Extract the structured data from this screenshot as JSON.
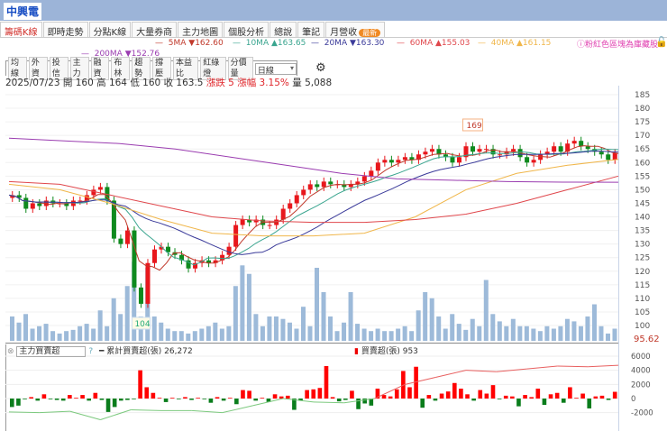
{
  "title": "中興電",
  "tabs": [
    {
      "label": "籌碼K線",
      "active": true
    },
    {
      "label": "即時走勢"
    },
    {
      "label": "分點K線"
    },
    {
      "label": "大量券商"
    },
    {
      "label": "主力地圖"
    },
    {
      "label": "個股分析"
    },
    {
      "label": "總說"
    },
    {
      "label": "筆記"
    },
    {
      "label": "月營收",
      "badge": "最新"
    }
  ],
  "ma_legend": [
    {
      "label": "5MA",
      "dir": "▼",
      "value": "162.60",
      "color": "#c0392b"
    },
    {
      "label": "10MA",
      "dir": "▲",
      "value": "163.65",
      "color": "#3aa58f"
    },
    {
      "label": "20MA",
      "dir": "▼",
      "value": "163.30",
      "color": "#3b3b9a"
    },
    {
      "label": "60MA",
      "dir": "▲",
      "value": "155.03",
      "color": "#e0474c"
    },
    {
      "label": "40MA",
      "dir": "▲",
      "value": "161.15",
      "color": "#f0b64a"
    },
    {
      "label": "200MA",
      "dir": "▼",
      "value": "152.76",
      "color": "#9a3cb0"
    }
  ],
  "note": "粉紅色區塊為庫藏股",
  "toolbar": [
    "均線",
    "外資",
    "投信",
    "主力",
    "融資",
    "布林",
    "趨勢",
    "撐壓",
    "本益比",
    "紅綠燈",
    "分價量"
  ],
  "period_select": "日線",
  "info": {
    "date": "2025/07/23",
    "open": "開 160",
    "high": "高 164",
    "low": "低 160",
    "close": "收 163.5",
    "change": "漲跌 5",
    "pct": "漲幅 3.15%",
    "volume": "量 5,088"
  },
  "lower": {
    "select": "主力買賣超",
    "help": "?",
    "cum_label": "累計買賣超(張) 26,272",
    "daily_label": "買賣超(張) 953"
  },
  "chart_data": {
    "type": "candlestick",
    "y_ticks": [
      185,
      180,
      175,
      170,
      165,
      160,
      155,
      150,
      145,
      140,
      135,
      130,
      125,
      120,
      115,
      110,
      105,
      100
    ],
    "ylim": [
      95,
      187
    ],
    "last_label": "95.62",
    "high_marker": "169",
    "low_marker": "104",
    "closes": [
      148,
      147,
      143,
      145,
      144,
      146,
      145,
      145,
      144,
      146,
      146,
      148,
      150,
      151,
      146,
      132,
      130,
      135,
      114,
      108,
      123,
      128,
      129,
      127,
      126,
      124,
      121,
      123,
      124,
      123,
      124,
      126,
      129,
      137,
      139,
      138,
      139,
      137,
      137,
      139,
      143,
      145,
      148,
      150,
      152,
      151,
      153,
      152,
      152,
      151,
      152,
      153,
      155,
      157,
      160,
      161,
      160,
      161,
      162,
      161,
      163,
      164,
      165,
      163,
      162,
      160,
      162,
      166,
      164,
      165,
      165,
      163,
      163,
      164,
      165,
      162,
      160,
      161,
      163,
      164,
      166,
      164,
      167,
      168,
      166,
      165,
      164,
      163,
      161,
      163.5
    ],
    "volumes": [
      20,
      15,
      22,
      10,
      12,
      14,
      8,
      6,
      8,
      9,
      12,
      14,
      10,
      25,
      12,
      35,
      22,
      45,
      65,
      20,
      60,
      20,
      15,
      10,
      8,
      8,
      6,
      8,
      10,
      12,
      15,
      10,
      12,
      45,
      62,
      55,
      22,
      12,
      20,
      20,
      18,
      15,
      10,
      28,
      12,
      60,
      40,
      20,
      8,
      15,
      40,
      14,
      10,
      8,
      10,
      8,
      8,
      10,
      12,
      8,
      25,
      40,
      35,
      20,
      10,
      22,
      14,
      9,
      18,
      12,
      50,
      22,
      16,
      12,
      18,
      12,
      12,
      10,
      8,
      12,
      10,
      12,
      18,
      16,
      12,
      20,
      30,
      12,
      6,
      10
    ],
    "ma200": [
      169,
      168,
      167,
      165,
      162,
      159,
      156,
      154,
      153.5,
      153,
      152.8,
      152.76
    ],
    "ma60": [
      153,
      152,
      148,
      144,
      140,
      138.5,
      138,
      138,
      139,
      141,
      145,
      150,
      155.03
    ],
    "ma40": [
      152,
      150,
      145,
      139,
      134,
      133,
      133,
      134,
      140,
      150,
      156,
      159,
      161.15
    ],
    "flow": [
      -1200,
      -1000,
      -100,
      200,
      -300,
      600,
      -100,
      -200,
      -300,
      500,
      100,
      500,
      -300,
      800,
      -200,
      -1900,
      -1200,
      -300,
      -200,
      -100,
      4000,
      1600,
      800,
      100,
      -500,
      100,
      -100,
      200,
      -200,
      100,
      -100,
      -600,
      200,
      -300,
      100,
      -800,
      1200,
      1100,
      -300,
      100,
      -500,
      600,
      300,
      400,
      -1600,
      -300,
      1200,
      1300,
      1500,
      4600,
      200,
      -400,
      -200,
      1100,
      -1500,
      -700,
      -1000,
      1400,
      500,
      300,
      1300,
      3900,
      1600,
      4500,
      -1300,
      500,
      -300,
      700,
      1000,
      2200,
      1400,
      600,
      -300,
      1200,
      700,
      1900,
      -100,
      400,
      300,
      -1100,
      500,
      200,
      1400,
      -900,
      600,
      800,
      -600,
      1600,
      100,
      700,
      -1400,
      300,
      400,
      -200,
      953
    ],
    "cum_anchor": [
      -1900,
      -2000,
      -1800,
      -3000,
      -1600,
      -1700,
      -1700,
      -2000,
      -1000,
      0,
      -500,
      -600,
      0,
      2000,
      3000,
      4000,
      3800,
      4200,
      4600,
      4500,
      4700
    ]
  }
}
